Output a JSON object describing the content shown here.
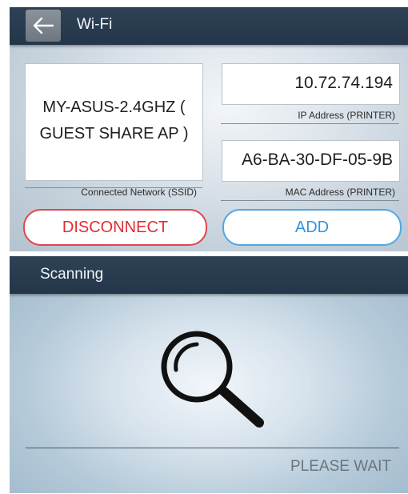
{
  "wifi_panel": {
    "title": "Wi-Fi",
    "back_icon": "arrow-left-icon",
    "ssid_value": "MY-ASUS-2.4GHZ ( GUEST SHARE AP )",
    "ssid_caption": "Connected Network (SSID)",
    "ip_value": "10.72.74.194",
    "ip_caption": "IP Address (PRINTER)",
    "mac_value": "A6-BA-30-DF-05-9B",
    "mac_caption": "MAC Address (PRINTER)",
    "disconnect_label": "DISCONNECT",
    "add_label": "ADD"
  },
  "scanning_panel": {
    "title": "Scanning",
    "icon": "magnifier-icon",
    "status": "PLEASE WAIT"
  },
  "colors": {
    "titlebar": "#2a3c50",
    "disconnect": "#e22b34",
    "add": "#2f95dd"
  }
}
